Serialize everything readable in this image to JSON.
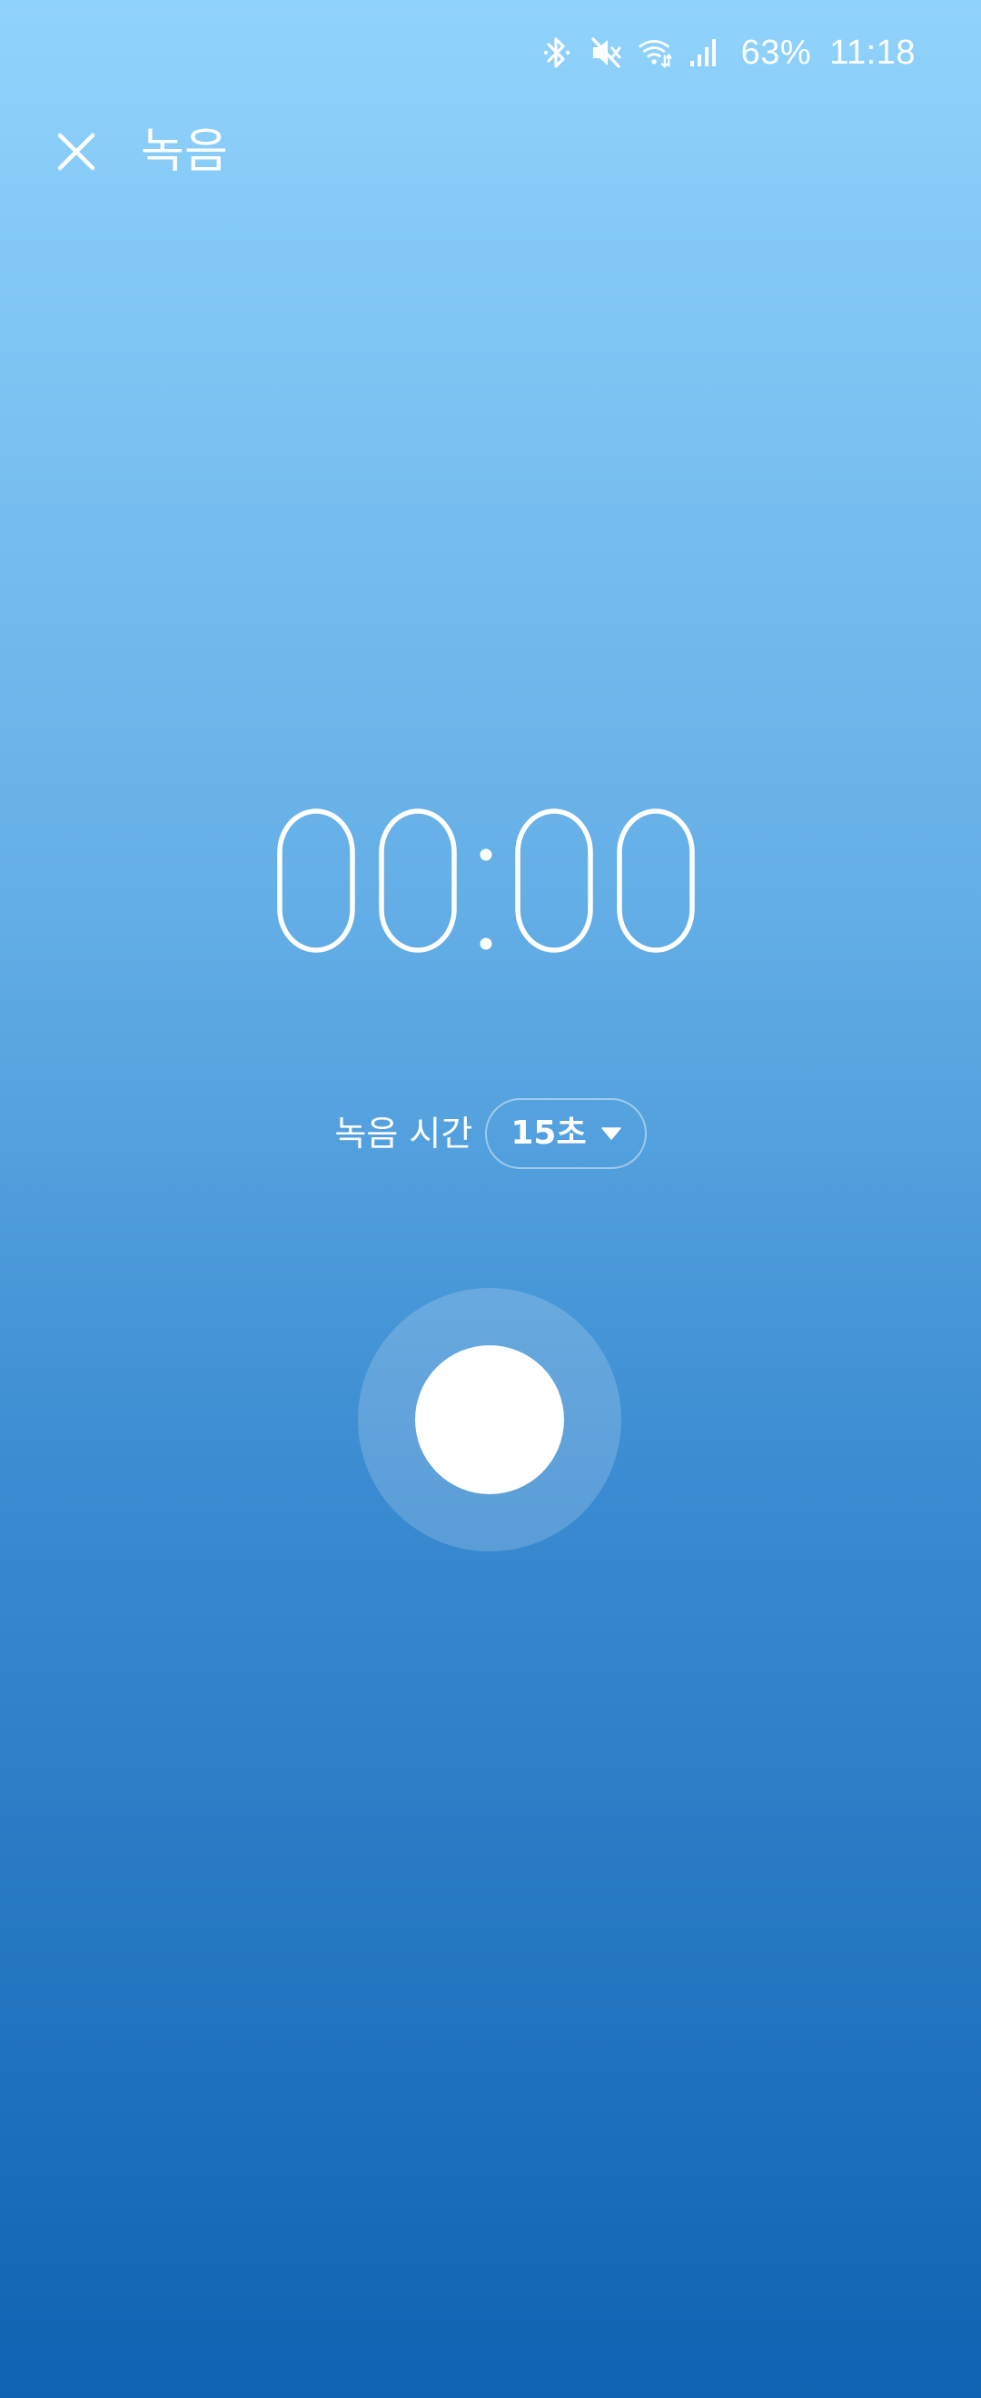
{
  "status_bar": {
    "battery": "63%",
    "time": "11:18",
    "icons": [
      "bluetooth-icon",
      "mute-icon",
      "wifi-icon",
      "signal-icon"
    ]
  },
  "app_bar": {
    "title": "녹음",
    "close_icon": "close-icon"
  },
  "timer": {
    "minutes": "00",
    "seconds": "00",
    "display": "00:00"
  },
  "duration": {
    "label": "녹음 시간",
    "selected": "15초",
    "dropdown_icon": "caret-down-icon"
  },
  "record_button": {
    "icon": "record-icon"
  },
  "colors": {
    "gradient_top": "#90d3fc",
    "gradient_bottom": "#0f63b2",
    "foreground": "#ffffff"
  }
}
